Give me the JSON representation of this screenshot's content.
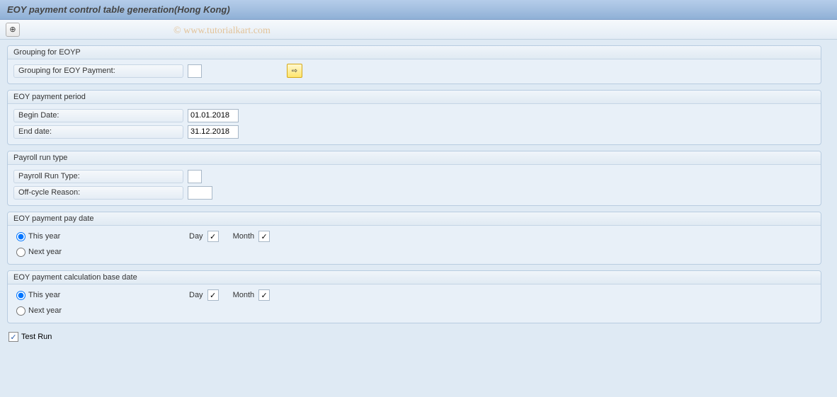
{
  "title": "EOY payment control table generation(Hong Kong)",
  "watermark": "© www.tutorialkart.com",
  "groups": {
    "grouping": {
      "title": "Grouping for EOYP",
      "field_label": "Grouping for EOY Payment:",
      "value": ""
    },
    "period": {
      "title": "EOY payment period",
      "begin_label": "Begin Date:",
      "begin_value": "01.01.2018",
      "end_label": "End date:",
      "end_value": "31.12.2018"
    },
    "runtype": {
      "title": "Payroll run type",
      "type_label": "Payroll Run Type:",
      "type_value": "",
      "reason_label": "Off-cycle Reason:",
      "reason_value": ""
    },
    "paydate": {
      "title": "EOY payment pay date",
      "this_year": "This year",
      "next_year": "Next year",
      "day_label": "Day",
      "month_label": "Month"
    },
    "calcbase": {
      "title": "EOY payment calculation base date",
      "this_year": "This year",
      "next_year": "Next year",
      "day_label": "Day",
      "month_label": "Month"
    }
  },
  "test_run_label": "Test Run",
  "checkmark": "✓"
}
